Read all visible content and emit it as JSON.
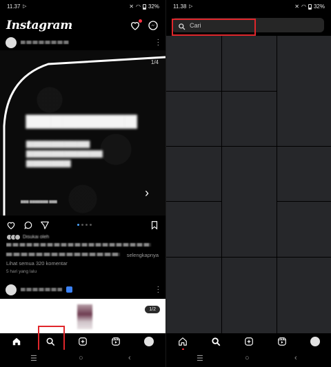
{
  "left_screen": {
    "status": {
      "time": "11.37",
      "battery": "32%"
    },
    "app_title": "Instagram",
    "post": {
      "image_counter": "1/4",
      "comments_link": "Lihat semua 320 komentar",
      "more_link": "selengkapnya",
      "time_ago": "5 hari yang lalu",
      "liked_by_text": "Disukai oleh"
    },
    "post2": {
      "image_counter": "1/2"
    },
    "icons": {
      "heart": "heart-icon",
      "messenger": "messenger-icon",
      "like": "like-icon",
      "comment": "comment-icon",
      "share": "share-icon",
      "save": "bookmark-icon",
      "home": "home-icon",
      "search": "search-icon",
      "create": "plus-square-icon",
      "reels": "reels-icon",
      "profile": "avatar"
    }
  },
  "right_screen": {
    "status": {
      "time": "11.38",
      "battery": "32%"
    },
    "search": {
      "placeholder": "Cari"
    }
  },
  "colors": {
    "background": "#000000",
    "grid_tile": "#26272a",
    "search_bg": "#262626",
    "highlight": "#e0262b",
    "notification_dot": "#ff3040",
    "carousel_active": "#4aa3ff"
  }
}
